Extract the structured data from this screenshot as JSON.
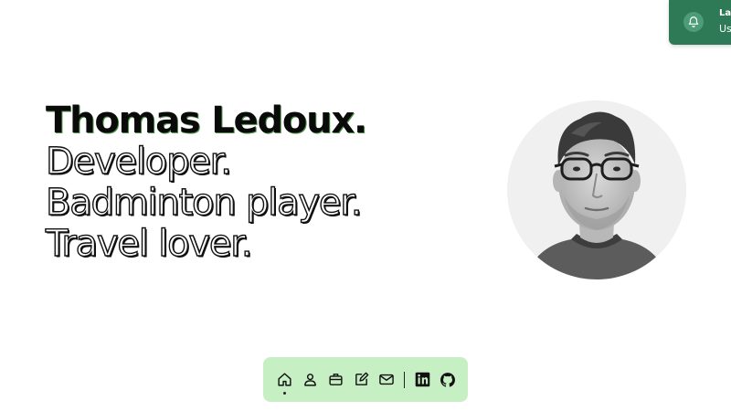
{
  "toast": {
    "title": "Lat",
    "text": "Us",
    "icon": "bell-icon",
    "background": "#2e7a57"
  },
  "hero": {
    "name": "Thomas Ledoux.",
    "roles": [
      "Developer.",
      "Badminton player.",
      "Travel lover."
    ]
  },
  "avatar": {
    "alt": "Thomas Ledoux"
  },
  "dock": {
    "background": "#c6efc3",
    "items": [
      {
        "name": "home",
        "icon": "home-icon",
        "active": true
      },
      {
        "name": "about",
        "icon": "user-icon"
      },
      {
        "name": "work",
        "icon": "briefcase-icon"
      },
      {
        "name": "blog",
        "icon": "pencil-icon"
      },
      {
        "name": "contact",
        "icon": "mail-icon"
      },
      {
        "name": "linkedin",
        "icon": "linkedin-icon",
        "label": "in"
      },
      {
        "name": "github",
        "icon": "github-icon"
      }
    ]
  }
}
